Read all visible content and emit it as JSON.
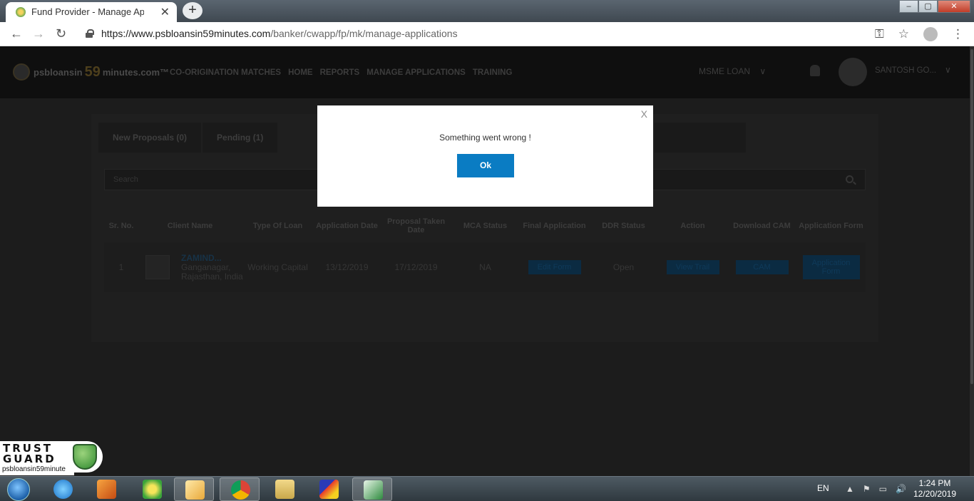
{
  "browser": {
    "tab_title": "Fund Provider - Manage Applicat",
    "tab_close": "✕",
    "new_tab": "+",
    "url_host": "https://www.psbloansin59minutes.com",
    "url_path": "/banker/cwapp/fp/mk/manage-applications",
    "window_controls": {
      "minimize": "–",
      "maximize": "▢",
      "close": "✕"
    }
  },
  "site": {
    "logo_left": "psbloansin",
    "logo_number": "59",
    "logo_right": "minutes.com™",
    "nav": [
      "CO-ORIGINATION MATCHES",
      "HOME",
      "REPORTS",
      "MANAGE APPLICATIONS",
      "TRAINING"
    ],
    "loan_type": "MSME LOAN",
    "user_name": "SANTOSH GO..."
  },
  "tabs": [
    "New Proposals (0)",
    "Pending (1)"
  ],
  "search": {
    "placeholder": "Search"
  },
  "table": {
    "headers": [
      "Sr. No.",
      "Client Name",
      "Type Of Loan",
      "Application Date",
      "Proposal Taken Date",
      "MCA Status",
      "Final Application",
      "DDR Status",
      "Action",
      "Download CAM",
      "Application Form"
    ],
    "rows": [
      {
        "sr": "1",
        "client_name": "ZAMIND...",
        "client_location": "Ganganagar, Rajasthan, India",
        "loan_type": "Working Capital",
        "application_date": "13/12/2019",
        "proposal_date": "17/12/2019",
        "mca_status": "NA",
        "final_application": "Edit Form",
        "ddr_status": "Open",
        "action": "View Trail",
        "download_cam": "CAM",
        "application_form": "Application Form"
      }
    ]
  },
  "modal": {
    "close": "X",
    "message": "Something went wrong !",
    "ok_label": "Ok"
  },
  "trust_guard": {
    "line1": "TRUST",
    "line2": "GUARD",
    "site": "psbloansin59minute"
  },
  "taskbar": {
    "language": "EN",
    "time": "1:24 PM",
    "date": "12/20/2019",
    "items": [
      "windows-media-player",
      "green-app",
      "outlook",
      "chrome",
      "file-explorer",
      "paint-app",
      "excel"
    ]
  },
  "colors": {
    "ok_button": "#0a7cc3",
    "overlay": "#1c1c1c"
  }
}
